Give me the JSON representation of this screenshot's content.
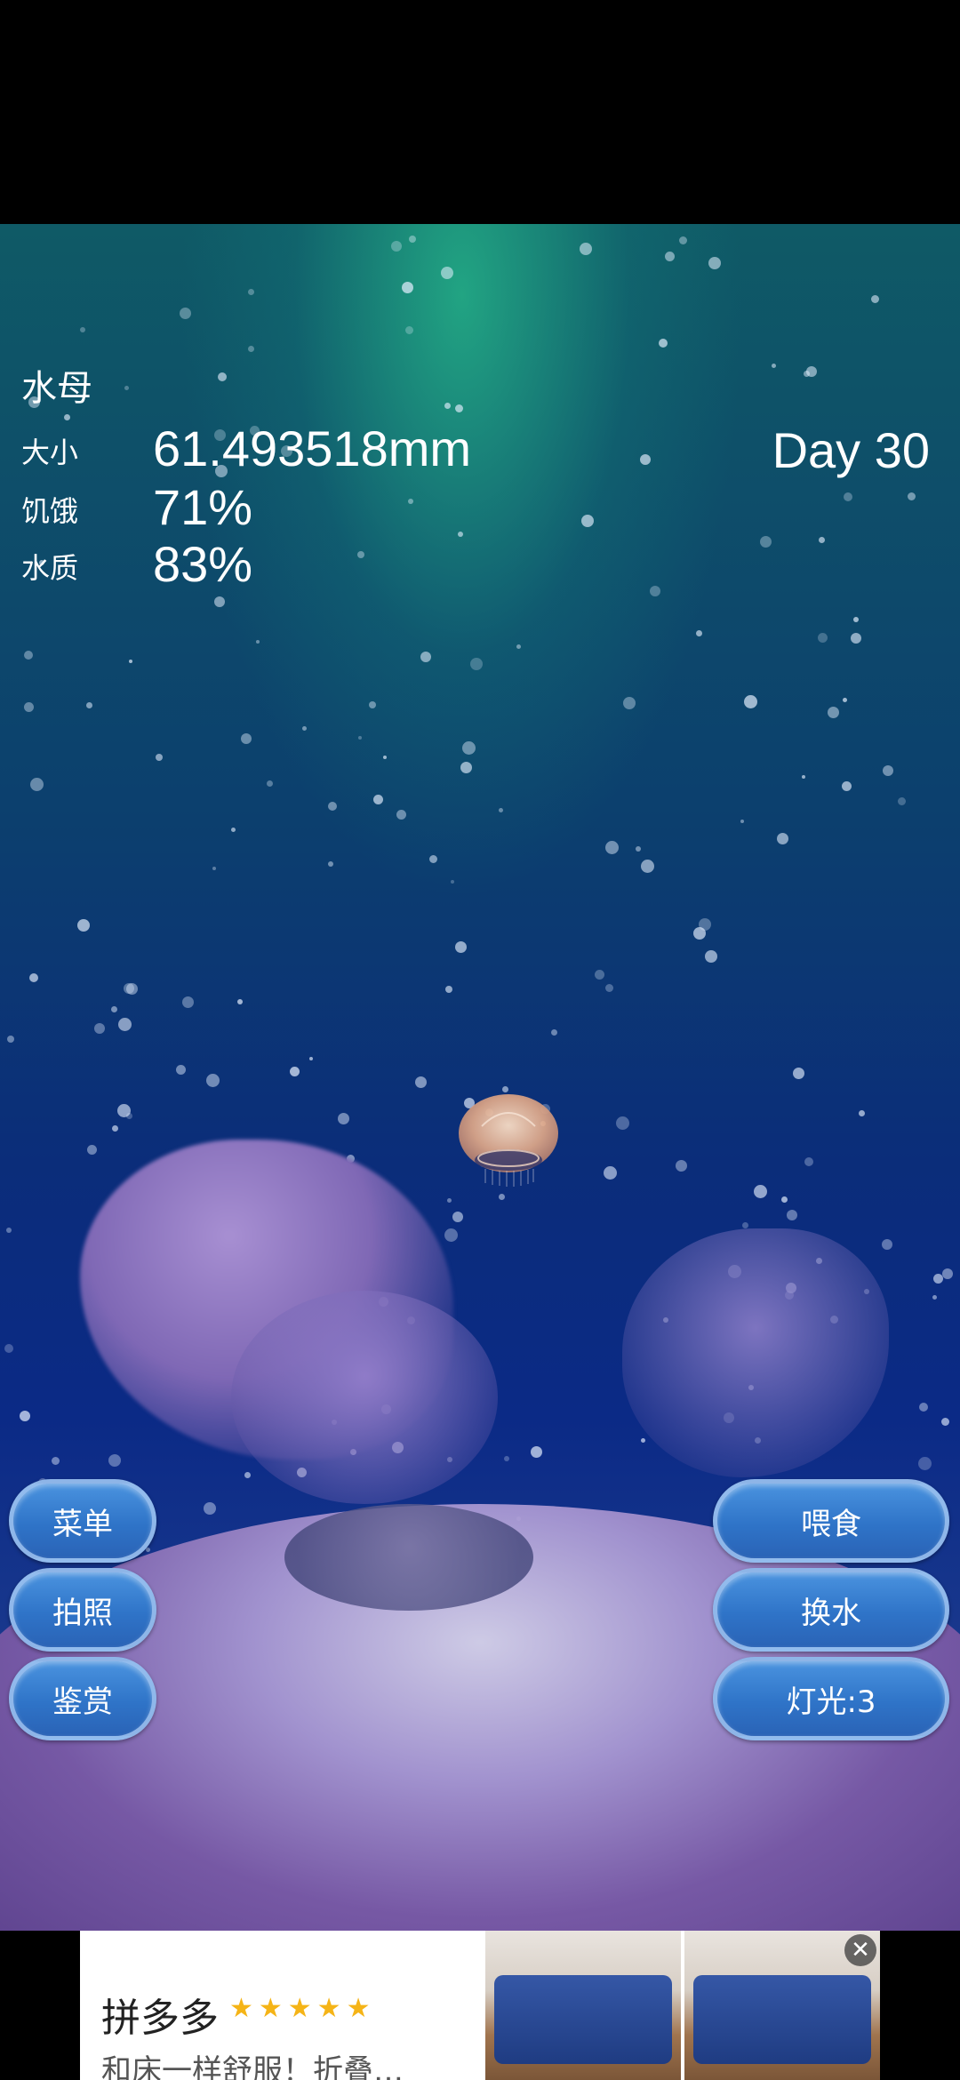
{
  "stats": {
    "title": "水母",
    "size_label": "大小",
    "size_value": "61.493518mm",
    "hunger_label": "饥饿",
    "hunger_value": "71%",
    "water_label": "水质",
    "water_value": "83%",
    "day": "Day 30"
  },
  "buttons": {
    "menu": "菜单",
    "photo": "拍照",
    "appreciate": "鉴赏",
    "feed": "喂食",
    "change_water": "换水",
    "light": "灯光:3"
  },
  "ad": {
    "brand": "拼多多",
    "stars": "★★★★★",
    "description": "和床一样舒服！折叠…",
    "close_icon": "close-icon"
  },
  "colors": {
    "button": "#2f74c8",
    "button_border": "#a0c3f0",
    "star": "#f5b417"
  }
}
